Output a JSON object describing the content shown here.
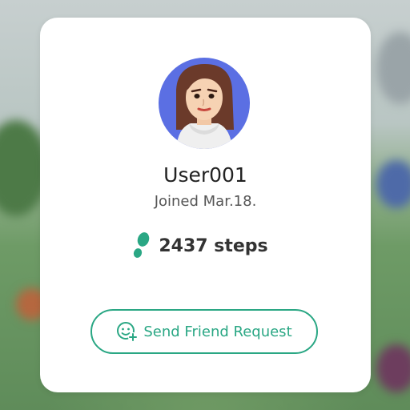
{
  "profile": {
    "username": "User001",
    "joined": "Joined Mar.18.",
    "steps": "2437 steps"
  },
  "actions": {
    "send_friend_request": "Send Friend Request"
  },
  "icons": {
    "avatar": "mii-avatar",
    "steps": "footprint-icon",
    "friend": "add-friend-icon"
  },
  "colors": {
    "accent": "#2aa784",
    "avatar_bg": "#5b6fe3"
  }
}
